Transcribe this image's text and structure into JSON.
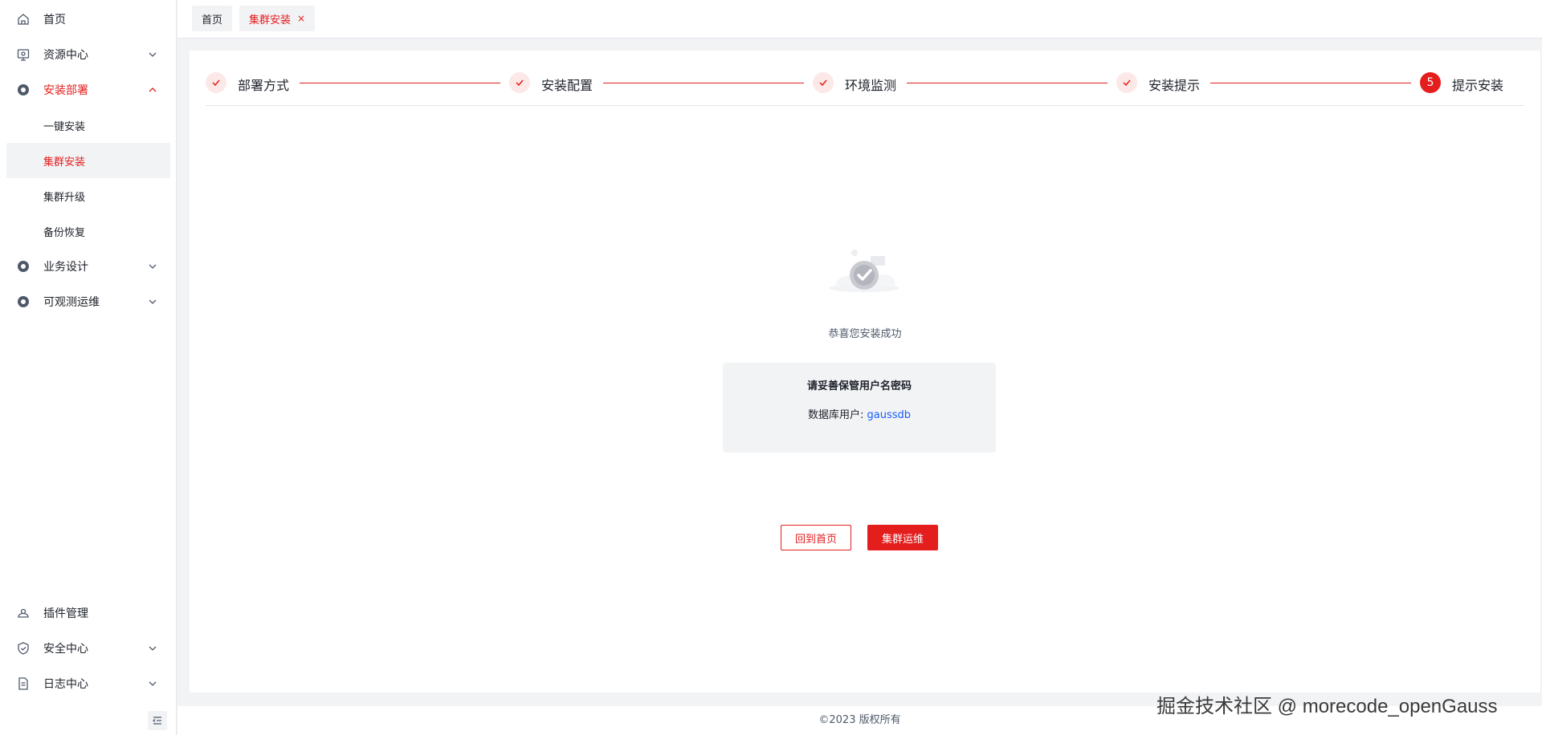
{
  "sidebar": {
    "menu": [
      {
        "label": "首页",
        "icon": "home-icon"
      },
      {
        "label": "资源中心",
        "icon": "resource-icon"
      },
      {
        "label": "安装部署",
        "icon": "gear-icon",
        "expanded": true
      },
      {
        "label": "业务设计",
        "icon": "gear-icon"
      },
      {
        "label": "可观测运维",
        "icon": "gear-icon"
      },
      {
        "label": "插件管理",
        "icon": "plugin-icon"
      },
      {
        "label": "安全中心",
        "icon": "shield-icon"
      },
      {
        "label": "日志中心",
        "icon": "document-icon"
      }
    ],
    "submenu": [
      {
        "label": "一键安装"
      },
      {
        "label": "集群安装",
        "selected": true
      },
      {
        "label": "集群升级"
      },
      {
        "label": "备份恢复"
      }
    ]
  },
  "tabs": [
    {
      "label": "首页"
    },
    {
      "label": "集群安装",
      "active": true,
      "close": "×"
    }
  ],
  "steps": [
    {
      "title": "部署方式",
      "status": "done"
    },
    {
      "title": "安装配置",
      "status": "done"
    },
    {
      "title": "环境监测",
      "status": "done"
    },
    {
      "title": "安装提示",
      "status": "done"
    },
    {
      "title": "提示安装",
      "status": "current",
      "number": "5"
    }
  ],
  "result": {
    "title": "恭喜您安装成功",
    "credentials_title": "请妥善保管用户名密码",
    "db_user_label": "数据库用户: ",
    "db_user_value": "gaussdb"
  },
  "buttons": {
    "back_home": "回到首页",
    "cluster_ops": "集群运维"
  },
  "footer": {
    "copyright": "©2023 版权所有"
  },
  "watermark": "掘金技术社区 @ morecode_openGauss",
  "colors": {
    "accent": "#e41d1d",
    "link": "#165dff",
    "step_done_bg": "#fde8e8"
  }
}
